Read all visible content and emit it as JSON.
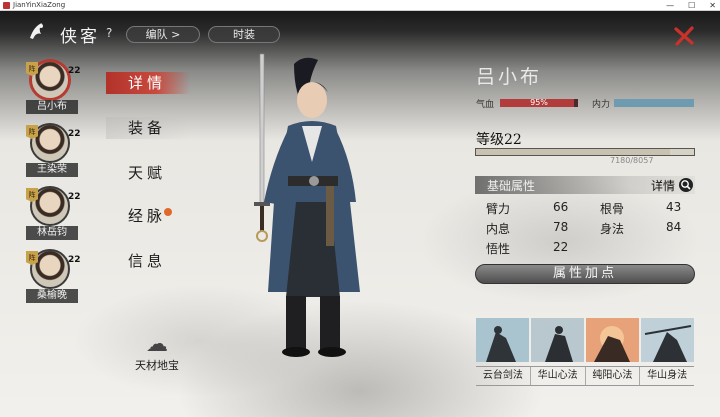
{
  "window": {
    "title": "JianYinXiaZong",
    "controls": [
      "—",
      "☐",
      "✕"
    ]
  },
  "header": {
    "title": "侠客",
    "help": "?",
    "team_label": "编队  >",
    "fashion_label": "时装"
  },
  "roster": [
    {
      "name": "吕小布",
      "level": "22",
      "badge": "阵",
      "selected": true
    },
    {
      "name": "王染荣",
      "level": "22",
      "badge": "阵",
      "selected": false
    },
    {
      "name": "林岳钧",
      "level": "22",
      "badge": "阵",
      "selected": false
    },
    {
      "name": "桑榆晚",
      "level": "22",
      "badge": "阵",
      "selected": false
    }
  ],
  "menu": [
    {
      "label": "详情",
      "active": true
    },
    {
      "label": "装备",
      "active": false
    },
    {
      "label": "天赋",
      "active": false
    },
    {
      "label": "经脉",
      "active": false,
      "alert": true
    },
    {
      "label": "信息",
      "active": false
    }
  ],
  "treasure_label": "天材地宝",
  "hero": {
    "name": "吕小布",
    "hp_label": "气血",
    "hp_text": "95%",
    "hp_fraction": 0.95,
    "mp_label": "内力",
    "mp_fraction": 1.0,
    "level_text": "等级22",
    "exp_text": "7180/8057",
    "exp_fraction": 0.891
  },
  "attributes": {
    "section_title": "基础属性",
    "details_label": "详情",
    "items": [
      {
        "key": "臂力",
        "value": "66"
      },
      {
        "key": "根骨",
        "value": "43"
      },
      {
        "key": "内息",
        "value": "78"
      },
      {
        "key": "身法",
        "value": "84"
      },
      {
        "key": "悟性",
        "value": "22"
      }
    ],
    "allocate_label": "属性加点"
  },
  "skills": [
    "云台剑法",
    "华山心法",
    "纯阳心法",
    "华山身法"
  ],
  "colors": {
    "accent": "#b8372e",
    "hp": "#b23c3c",
    "mp": "#6f9bb0"
  }
}
